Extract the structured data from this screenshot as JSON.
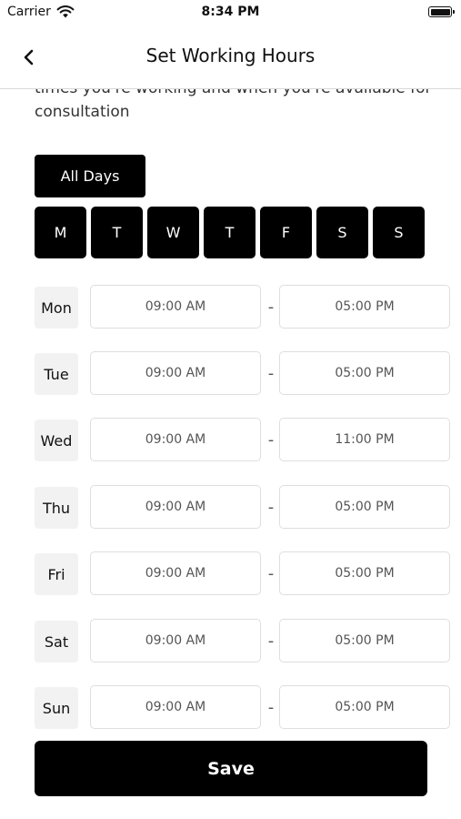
{
  "status_bar": {
    "carrier": "Carrier",
    "time": "8:34 PM"
  },
  "nav": {
    "title": "Set Working Hours",
    "back_icon": "chevron-left-icon"
  },
  "description": "times you're working and when you're available for consultation",
  "all_days_label": "All Days",
  "day_buttons": [
    "M",
    "T",
    "W",
    "T",
    "F",
    "S",
    "S"
  ],
  "schedule": [
    {
      "day": "Mon",
      "start": "09:00 AM",
      "end": "05:00 PM"
    },
    {
      "day": "Tue",
      "start": "09:00 AM",
      "end": "05:00 PM"
    },
    {
      "day": "Wed",
      "start": "09:00 AM",
      "end": "11:00 PM"
    },
    {
      "day": "Thu",
      "start": "09:00 AM",
      "end": "05:00 PM"
    },
    {
      "day": "Fri",
      "start": "09:00 AM",
      "end": "05:00 PM"
    },
    {
      "day": "Sat",
      "start": "09:00 AM",
      "end": "05:00 PM"
    },
    {
      "day": "Sun",
      "start": "09:00 AM",
      "end": "05:00 PM"
    }
  ],
  "separator": "-",
  "save_label": "Save",
  "colors": {
    "primary": "#000000",
    "primary_text": "#ffffff",
    "day_label_bg": "#f2f2f2",
    "field_border": "#dedede"
  }
}
